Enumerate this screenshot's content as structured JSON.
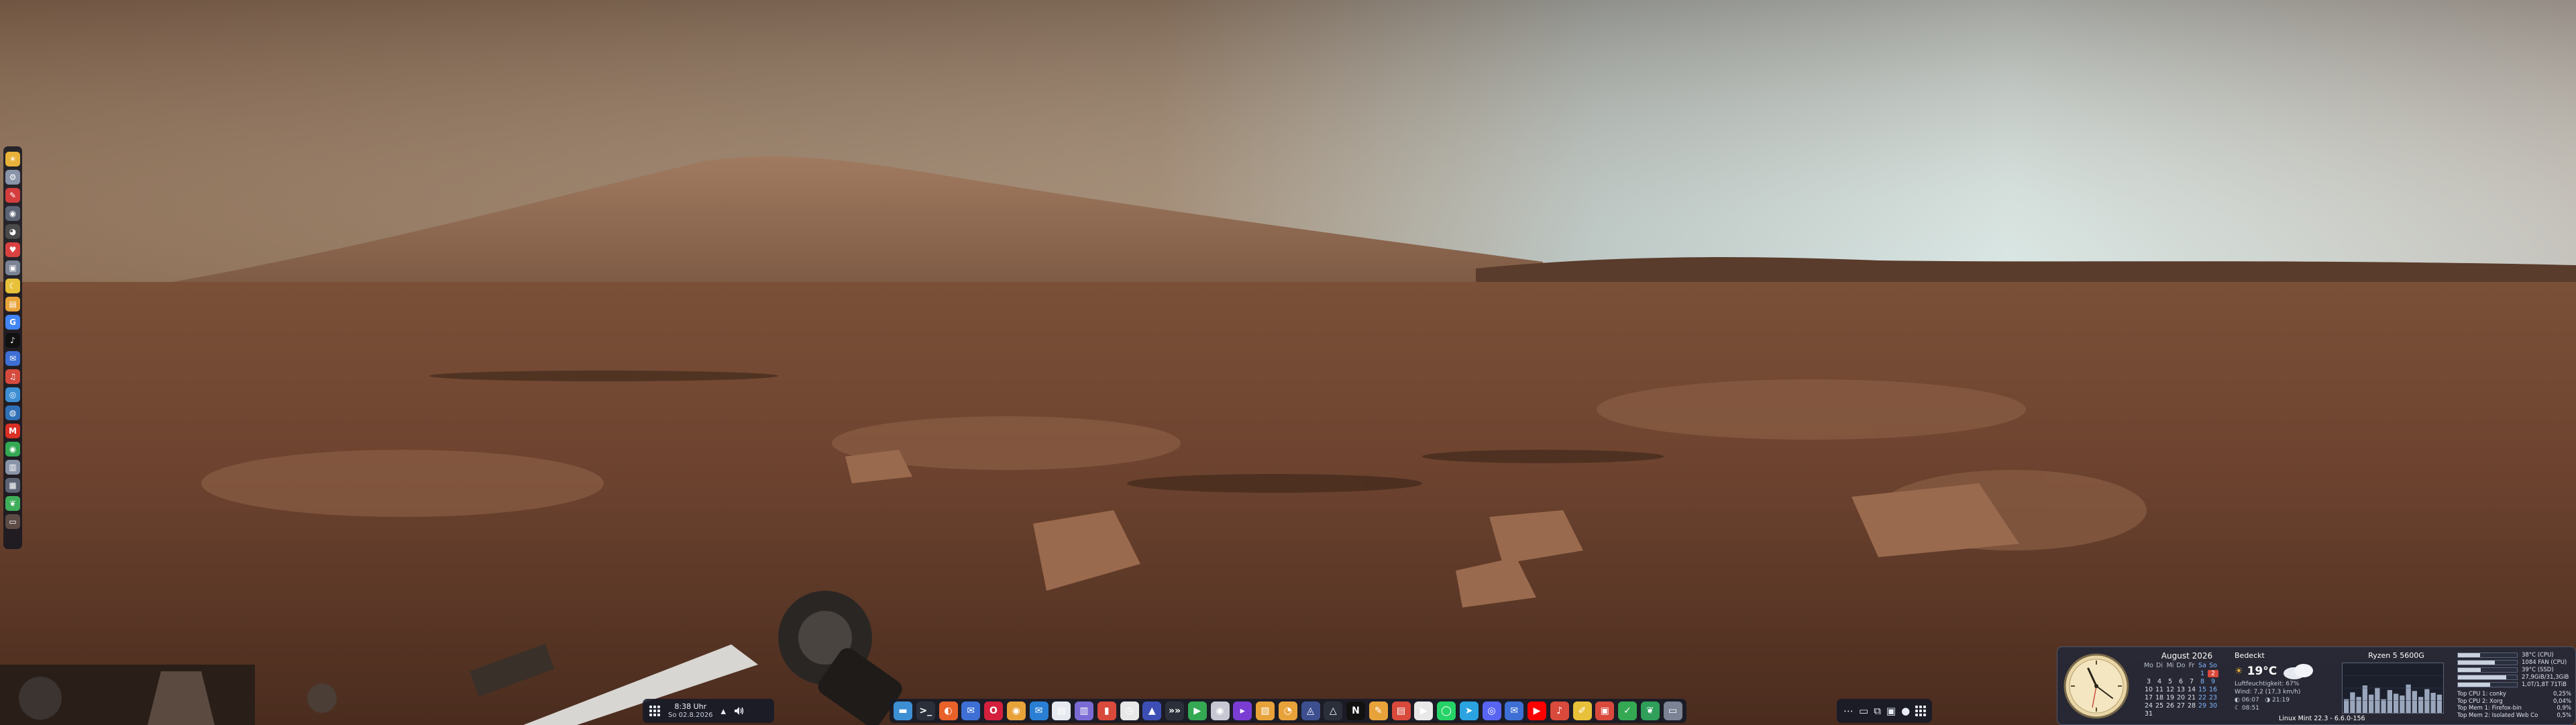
{
  "left_dock": {
    "icons": [
      {
        "name": "sun-icon",
        "glyph": "☀",
        "color": "#e8b23a"
      },
      {
        "name": "settings-gear-icon",
        "glyph": "⚙",
        "color": "#8a94a8"
      },
      {
        "name": "pen-icon",
        "glyph": "✎",
        "color": "#d43d3d"
      },
      {
        "name": "eye-icon",
        "glyph": "◉",
        "color": "#5c6474"
      },
      {
        "name": "pie-icon",
        "glyph": "◕",
        "color": "#4a4a4a"
      },
      {
        "name": "heart-icon",
        "glyph": "♥",
        "color": "#d94141"
      },
      {
        "name": "display-icon",
        "glyph": "▣",
        "color": "#7b8394"
      },
      {
        "name": "moon-icon",
        "glyph": "☾",
        "color": "#e8c13a"
      },
      {
        "name": "file-icon",
        "glyph": "▤",
        "color": "#e8a43a"
      },
      {
        "name": "google-icon",
        "glyph": "G",
        "color": "#4285f4"
      },
      {
        "name": "tiktok-icon",
        "glyph": "♪",
        "color": "#111111"
      },
      {
        "name": "mail-icon",
        "glyph": "✉",
        "color": "#3d6fd4"
      },
      {
        "name": "audio-icon",
        "glyph": "♫",
        "color": "#d44b3d"
      },
      {
        "name": "browser-icon",
        "glyph": "◎",
        "color": "#3d8fd4"
      },
      {
        "name": "globe-icon",
        "glyph": "◍",
        "color": "#2f6fb5"
      },
      {
        "name": "gmail-icon",
        "glyph": "M",
        "color": "#d93025"
      },
      {
        "name": "chrome-icon",
        "glyph": "◉",
        "color": "#34a853"
      },
      {
        "name": "document-icon",
        "glyph": "▥",
        "color": "#8a94a8"
      },
      {
        "name": "server-icon",
        "glyph": "▦",
        "color": "#5c6474"
      },
      {
        "name": "leaf-icon",
        "glyph": "❦",
        "color": "#3fae5a"
      },
      {
        "name": "trash-icon",
        "glyph": "▭",
        "color": "#5c4a44"
      }
    ]
  },
  "taskbar_left": {
    "time": "8:38 Uhr",
    "date": "So 02.8.2026"
  },
  "taskbar_center": {
    "apps": [
      {
        "name": "files-icon",
        "glyph": "▬",
        "color": "#3d8fd4"
      },
      {
        "name": "terminal-icon",
        "glyph": ">_",
        "color": "#2b2f3a"
      },
      {
        "name": "firefox-icon",
        "glyph": "◐",
        "color": "#e8622a"
      },
      {
        "name": "email-client-icon",
        "glyph": "✉",
        "color": "#3d6fd4"
      },
      {
        "name": "opera-icon",
        "glyph": "O",
        "color": "#d4203d"
      },
      {
        "name": "chrome-icon",
        "glyph": "◉",
        "color": "#e8a23a"
      },
      {
        "name": "mail-icon",
        "glyph": "✉",
        "color": "#2a7fd4"
      },
      {
        "name": "document-icon",
        "glyph": "▤",
        "color": "#e6e9ef"
      },
      {
        "name": "notes-icon",
        "glyph": "▥",
        "color": "#7a6bd4"
      },
      {
        "name": "app-red-icon",
        "glyph": "▮",
        "color": "#d94a3c"
      },
      {
        "name": "clock-icon",
        "glyph": "◷",
        "color": "#e8e8e8"
      },
      {
        "name": "vpn-icon",
        "glyph": "▲",
        "color": "#3d4fb5"
      },
      {
        "name": "arrows-icon",
        "glyph": "»»",
        "color": "#2b2f3a"
      },
      {
        "name": "play-store-icon",
        "glyph": "▶",
        "color": "#34a853"
      },
      {
        "name": "player-icon",
        "glyph": "◉",
        "color": "#c7c7d4"
      },
      {
        "name": "media-icon",
        "glyph": "▸",
        "color": "#7a3dd4"
      },
      {
        "name": "archive-icon",
        "glyph": "▧",
        "color": "#e8a23a"
      },
      {
        "name": "update-icon",
        "glyph": "◔",
        "color": "#e8a23a"
      },
      {
        "name": "network-icon",
        "glyph": "◬",
        "color": "#3d4f8f"
      },
      {
        "name": "triangle-icon",
        "glyph": "△",
        "color": "#2b2f3a"
      },
      {
        "name": "netflix-icon",
        "glyph": "N",
        "color": "#111111"
      },
      {
        "name": "pencil-icon",
        "glyph": "✎",
        "color": "#e8a23a"
      },
      {
        "name": "reader-icon",
        "glyph": "▤",
        "color": "#d94a3c"
      },
      {
        "name": "video-icon",
        "glyph": "▶",
        "color": "#e8e8e8"
      },
      {
        "name": "whatsapp-icon",
        "glyph": "◯",
        "color": "#25d366"
      },
      {
        "name": "telegram-icon",
        "glyph": "➤",
        "color": "#2aa3e0"
      },
      {
        "name": "discord-icon",
        "glyph": "◎",
        "color": "#5865f2"
      },
      {
        "name": "mailbox-icon",
        "glyph": "✉",
        "color": "#3d6fd4"
      },
      {
        "name": "youtube-icon",
        "glyph": "▶",
        "color": "#ff0000"
      },
      {
        "name": "speaker-icon",
        "glyph": "♪",
        "color": "#d94a3c"
      },
      {
        "name": "pen-tool-icon",
        "glyph": "✐",
        "color": "#e8c13a"
      },
      {
        "name": "gift-icon",
        "glyph": "▣",
        "color": "#d94a3c"
      },
      {
        "name": "check-icon",
        "glyph": "✓",
        "color": "#34a853"
      },
      {
        "name": "leaf-icon",
        "glyph": "❦",
        "color": "#2f9f5a"
      },
      {
        "name": "window-icon",
        "glyph": "▭",
        "color": "#7b8394"
      }
    ]
  },
  "widget": {
    "calendar": {
      "title": "August 2026",
      "weekdays": [
        "Mo",
        "Di",
        "Mi",
        "Do",
        "Fr",
        "Sa",
        "So"
      ],
      "days": [
        "",
        "",
        "",
        "",
        "",
        "1",
        "2",
        "3",
        "4",
        "5",
        "6",
        "7",
        "8",
        "9",
        "10",
        "11",
        "12",
        "13",
        "14",
        "15",
        "16",
        "17",
        "18",
        "19",
        "20",
        "21",
        "22",
        "23",
        "24",
        "25",
        "26",
        "27",
        "28",
        "29",
        "30",
        "31",
        "",
        "",
        "",
        "",
        "",
        ""
      ],
      "today": "2"
    },
    "weather": {
      "condition": "Bedeckt",
      "temperature": "19°C",
      "humidity": "Luftfeuchtigkeit: 67%",
      "wind": "Wind: 7,2 (17,3 km/h)",
      "sunrise": "06:07",
      "sunset": "21:19",
      "moon": "08:51"
    },
    "cpu": {
      "title": "Ryzen 5 5600G",
      "graph_load": [
        0.3,
        0.45,
        0.35,
        0.6,
        0.4,
        0.55,
        0.3,
        0.5,
        0.42,
        0.38,
        0.62,
        0.48,
        0.35,
        0.52,
        0.44,
        0.4
      ]
    },
    "stats": [
      {
        "label": "38°C (CPU)",
        "fill": 0.38
      },
      {
        "label": "1084 FAN (CPU)",
        "fill": 0.62
      },
      {
        "label": "39°C (SSD)",
        "fill": 0.39
      },
      {
        "label": "27,9GiB/31,3GiB",
        "fill": 0.82
      },
      {
        "label": "1,0T/1,8T 71TiB",
        "fill": 0.55
      }
    ],
    "top": [
      {
        "name": "Top CPU 1: conky",
        "value": "0,25%"
      },
      {
        "name": "Top CPU 2: Xorg",
        "value": "0,04%"
      },
      {
        "name": "Top Mem 1: Firefox-bin",
        "value": "0,9%"
      },
      {
        "name": "Top Mem 2: Isolated Web Co",
        "value": "0,5%"
      }
    ],
    "os": "Linux Mint 22.3 - 6.6.0-156"
  }
}
